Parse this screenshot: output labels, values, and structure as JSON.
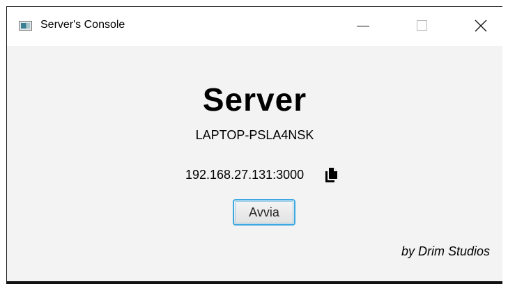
{
  "window": {
    "title": "Server's Console",
    "controls": {
      "minimize": "minimize-icon",
      "maximize": "maximize-icon",
      "close": "close-icon"
    }
  },
  "main": {
    "heading": "Server",
    "hostname": "LAPTOP-PSLA4NSK",
    "address": "192.168.27.131:3000",
    "copy_icon": "copy-icon",
    "start_button_label": "Avvia",
    "credit": "by Drim Studios"
  },
  "colors": {
    "focus_border": "#3ea9e0",
    "background": "#f3f3f3",
    "titlebar": "#ffffff"
  }
}
